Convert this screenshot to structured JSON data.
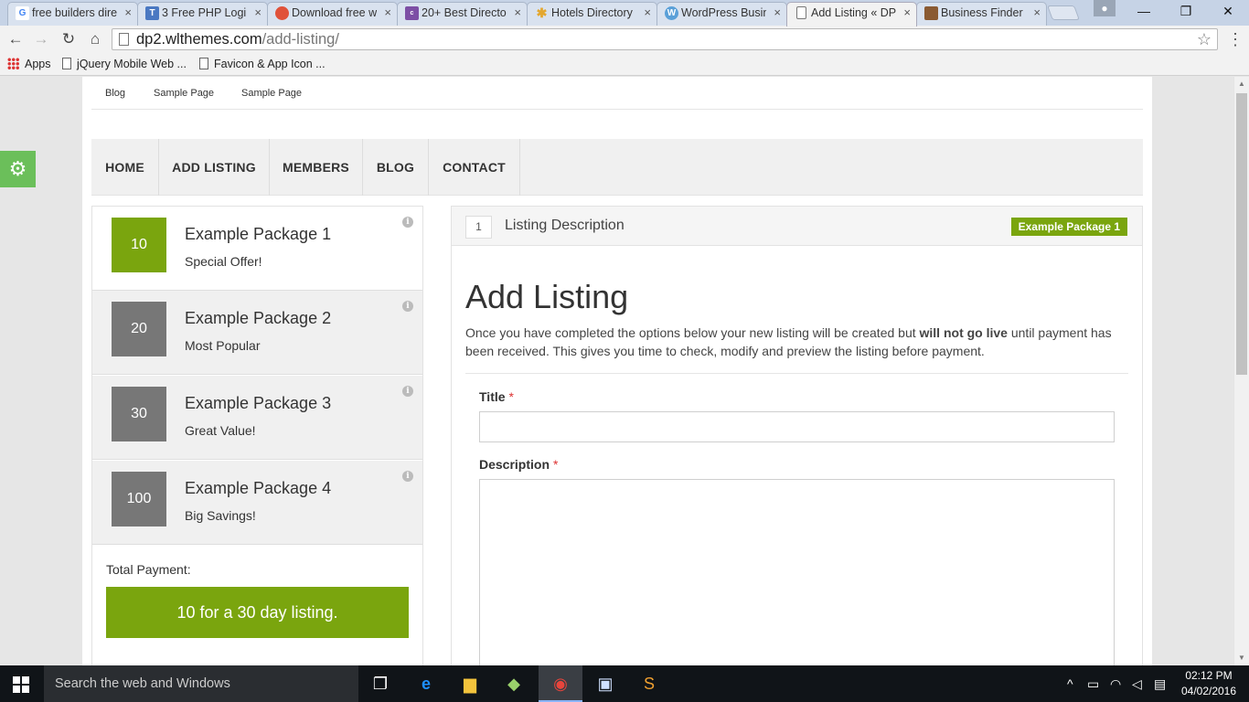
{
  "browser": {
    "tabs": [
      {
        "label": "free builders dire",
        "favicon": "google-icon",
        "color": "#4285f4",
        "glyph": "G"
      },
      {
        "label": "3 Free PHP Login",
        "favicon": "t-icon",
        "color": "#4a78c2",
        "glyph": "T"
      },
      {
        "label": "Download free w",
        "favicon": "hexagon-icon",
        "color": "#e0523a",
        "glyph": ""
      },
      {
        "label": "20+ Best Directo",
        "favicon": "colorlib-icon",
        "color": "#7d4fa5",
        "glyph": "c"
      },
      {
        "label": "Hotels Directory",
        "favicon": "star-burst-icon",
        "color": "#e3a72f",
        "glyph": "✱"
      },
      {
        "label": "WordPress Busin",
        "favicon": "wordpress-icon",
        "color": "#5aa0d8",
        "glyph": "W"
      },
      {
        "label": "Add Listing « DP",
        "favicon": "page-icon",
        "color": "#ffffff",
        "glyph": ""
      },
      {
        "label": "Business Finder",
        "favicon": "book-icon",
        "color": "#8a5a32",
        "glyph": ""
      }
    ],
    "url_domain": "dp2.wlthemes.com",
    "url_path": "/add-listing/",
    "bookmarks": [
      "Apps",
      "jQuery Mobile Web ...",
      "Favicon & App Icon ..."
    ]
  },
  "site": {
    "top_links": [
      "Blog",
      "Sample Page",
      "Sample Page"
    ],
    "main_nav": [
      "HOME",
      "ADD LISTING",
      "MEMBERS",
      "BLOG",
      "CONTACT"
    ]
  },
  "packages": [
    {
      "price": "10",
      "name": "Example Package 1",
      "desc": "Special Offer!"
    },
    {
      "price": "20",
      "name": "Example Package 2",
      "desc": "Most Popular"
    },
    {
      "price": "30",
      "name": "Example Package 3",
      "desc": "Great Value!"
    },
    {
      "price": "100",
      "name": "Example Package 4",
      "desc": "Big Savings!"
    }
  ],
  "payment": {
    "label": "Total Payment:",
    "button": "10 for a 30 day listing."
  },
  "form": {
    "step_number": "1",
    "step_title": "Listing Description",
    "selected_package": "Example Package 1",
    "title": "Add Listing",
    "intro_before": "Once you have completed the options below your new listing will be created but ",
    "intro_bold": "will not go live",
    "intro_after": " until payment has been received. This gives you time to check, modify and preview the listing before payment.",
    "fields": [
      {
        "label": "Title",
        "required": "*",
        "value": ""
      },
      {
        "label": "Description",
        "required": "*",
        "value": ""
      }
    ]
  },
  "taskbar": {
    "search_placeholder": "Search the web and Windows",
    "time": "02:12 PM",
    "date": "04/02/2016"
  },
  "colors": {
    "accent_green": "#7aa50e",
    "gear_green": "#6bbf5a"
  }
}
